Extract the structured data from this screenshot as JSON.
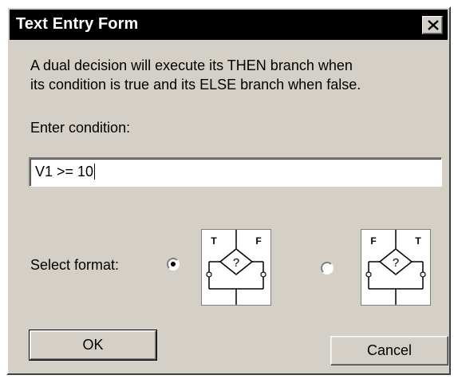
{
  "window": {
    "title": "Text Entry Form",
    "close_icon": "close-x-icon"
  },
  "description": {
    "line1": "A dual decision will execute its THEN branch when",
    "line2": "its condition is true and its ELSE branch when false."
  },
  "condition": {
    "label": "Enter condition:",
    "value": "V1 >= 10"
  },
  "format": {
    "label": "Select format:",
    "options": [
      {
        "id": "true-left",
        "selected": true,
        "left_branch": "T",
        "right_branch": "F",
        "question": "?"
      },
      {
        "id": "false-left",
        "selected": false,
        "left_branch": "F",
        "right_branch": "T",
        "question": "?"
      }
    ]
  },
  "buttons": {
    "ok_label": "OK",
    "cancel_label": "Cancel"
  }
}
